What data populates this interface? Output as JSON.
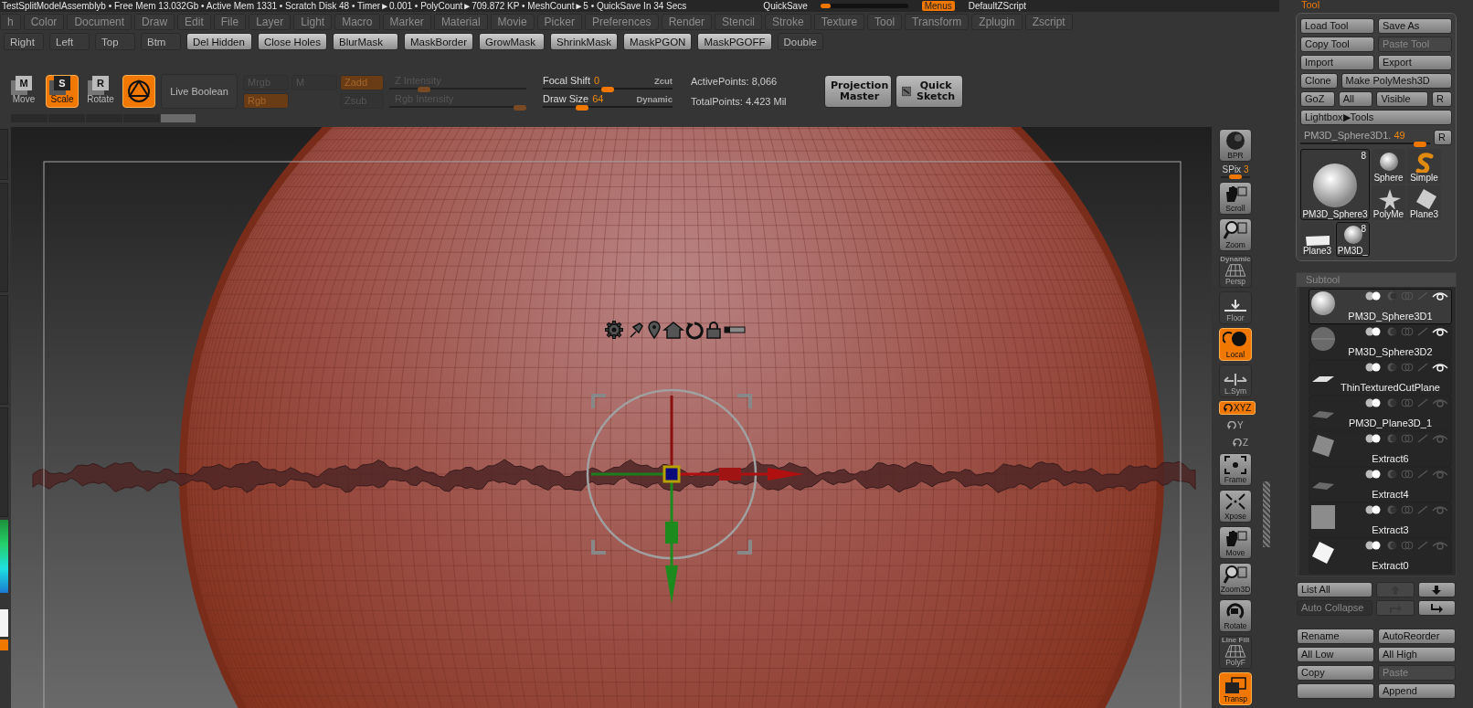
{
  "status_bar": {
    "text": "TestSplitModelAssemblyb  • Free Mem 13.032Gb • Active Mem 1331 • Scratch Disk 48 • Timer►0.001 • PolyCount►709.872 KP • MeshCount►5 • QuickSave In 34 Secs",
    "quicksave": "QuickSave",
    "see_through": {
      "level": 0.12
    },
    "menus": {
      "label": "Menus",
      "on": true
    },
    "script": "DefaultZScript"
  },
  "menu_bar": [
    "h",
    "Color",
    "Document",
    "Draw",
    "Edit",
    "File",
    "Layer",
    "Light",
    "Macro",
    "Marker",
    "Material",
    "Movie",
    "Picker",
    "Preferences",
    "Render",
    "Stencil",
    "Stroke",
    "Texture",
    "Tool",
    "Transform",
    "Zplugin",
    "Zscript"
  ],
  "custom_buttons": [
    {
      "label": "Right",
      "kind": "plain"
    },
    {
      "label": "Left",
      "kind": "plain"
    },
    {
      "label": "Top",
      "kind": "plain"
    },
    {
      "label": "Btm",
      "kind": "plain"
    },
    {
      "label": "Del Hidden",
      "kind": "raised"
    },
    {
      "label": "Close Holes",
      "kind": "raised"
    },
    {
      "label": "BlurMask",
      "kind": "raised"
    },
    {
      "label": "MaskBorder",
      "kind": "raised"
    },
    {
      "label": "GrowMask",
      "kind": "raised"
    },
    {
      "label": "ShrinkMask",
      "kind": "raised"
    },
    {
      "label": "MaskPGON",
      "kind": "raised"
    },
    {
      "label": "MaskPGOFF",
      "kind": "raised"
    },
    {
      "label": "Double",
      "kind": "plain"
    }
  ],
  "transform_modes": [
    {
      "label": "Move",
      "key": "M",
      "selected": false
    },
    {
      "label": "Scale",
      "key": "S",
      "selected": true
    },
    {
      "label": "Rotate",
      "key": "R",
      "selected": false
    }
  ],
  "edit_mode": {
    "on": true
  },
  "live_boolean": {
    "label": "Live Boolean",
    "on": false
  },
  "channels": [
    {
      "label": "Mrgb",
      "on": false
    },
    {
      "label": "M",
      "on": false
    },
    {
      "label": "Zadd",
      "on": true
    },
    {
      "label": "Rgb",
      "on": true
    },
    {
      "label": "Zsub",
      "on": false
    }
  ],
  "intensity_sliders": [
    {
      "label": "Z Intensity",
      "level": 0.25
    },
    {
      "label": "Rgb Intensity",
      "level": 0.95
    }
  ],
  "brush_sliders": [
    {
      "label": "Focal Shift",
      "value": "0",
      "level": 0.5,
      "note": "Zcut"
    },
    {
      "label": "Draw Size",
      "value": "64",
      "level": 0.3,
      "note": "Dynamic"
    }
  ],
  "stats": [
    "ActivePoints: 8,066",
    "TotalPoints: 4.423 Mil"
  ],
  "projection_master": "Projection Master",
  "quick_sketch": "Quick Sketch",
  "shelf": [
    {
      "kind": "action",
      "label": "BPR"
    },
    {
      "kind": "slider",
      "label": "SPix",
      "value": "3",
      "level": 0.5
    },
    {
      "kind": "action",
      "label": "Scroll"
    },
    {
      "kind": "action",
      "label": "Zoom"
    },
    {
      "kind": "toggle",
      "label": "Persp",
      "caption": "Dynamic",
      "on": false
    },
    {
      "kind": "toggle",
      "label": "Floor",
      "on": false
    },
    {
      "kind": "toggle",
      "label": "Local",
      "on": true
    },
    {
      "kind": "toggle",
      "label": "L.Sym",
      "on": false
    },
    {
      "kind": "axis",
      "label": "XYZ",
      "on": true
    },
    {
      "kind": "axis",
      "label": "Y",
      "on": false
    },
    {
      "kind": "axis",
      "label": "Z",
      "on": false
    },
    {
      "kind": "action",
      "label": "Frame"
    },
    {
      "kind": "action",
      "label": "Xpose"
    },
    {
      "kind": "action",
      "label": "Move"
    },
    {
      "kind": "action",
      "label": "Zoom3D"
    },
    {
      "kind": "action",
      "label": "Rotate"
    },
    {
      "kind": "toggle",
      "label": "PolyF",
      "caption": "Line Fill",
      "on": false
    },
    {
      "kind": "toggle",
      "label": "Transp",
      "on": true
    }
  ],
  "tool_palette": {
    "title": "Tool",
    "button_rows": [
      [
        {
          "label": "Load Tool",
          "disabled": false
        },
        {
          "label": "Save As",
          "disabled": false
        }
      ],
      [
        {
          "label": "Copy Tool",
          "disabled": false
        },
        {
          "label": "Paste Tool",
          "disabled": true
        }
      ],
      [
        {
          "label": "Import",
          "disabled": false
        },
        {
          "label": "Export",
          "disabled": false
        }
      ],
      [
        {
          "label": "Clone",
          "disabled": false
        },
        {
          "label": "Make PolyMesh3D",
          "disabled": false
        }
      ],
      [
        {
          "label": "GoZ",
          "disabled": false
        },
        {
          "label": "All",
          "disabled": false
        },
        {
          "label": "Visible",
          "disabled": false
        },
        {
          "label": "R",
          "disabled": false
        }
      ],
      [
        {
          "label": "Lightbox▶Tools",
          "disabled": false
        }
      ]
    ],
    "tool_slider": {
      "label": "PM3D_Sphere3D1.",
      "value": "49",
      "level": 0.92
    },
    "reset": "R",
    "thumbnails": [
      {
        "label": "PM3D_Sphere3",
        "badge": "8",
        "kind": "sphere",
        "selected": true
      },
      {
        "label": "Sphere",
        "kind": "sphere",
        "selected": false
      },
      {
        "label": "Simple",
        "kind": "snake",
        "selected": false
      },
      {
        "label": "PolyMe",
        "kind": "star",
        "selected": false
      },
      {
        "label": "Plane3",
        "kind": "plane",
        "selected": false
      },
      {
        "label": "Plane3",
        "kind": "flat",
        "selected": false
      },
      {
        "label": "PM3D_",
        "badge": "8",
        "kind": "sphere",
        "selected": true
      }
    ]
  },
  "subtool": {
    "title": "Subtool",
    "items": [
      {
        "name": "PM3D_Sphere3D1",
        "kind": "sphere",
        "selected": true,
        "visible": true
      },
      {
        "name": "PM3D_Sphere3D2",
        "kind": "sphere-dim",
        "selected": false,
        "visible": true
      },
      {
        "name": "ThinTexturedCutPlane",
        "kind": "plane",
        "selected": false,
        "visible": true
      },
      {
        "name": "PM3D_Plane3D_1",
        "kind": "plane-dim",
        "selected": false,
        "visible": false
      },
      {
        "name": "Extract6",
        "kind": "tile",
        "selected": false,
        "visible": false
      },
      {
        "name": "Extract4",
        "kind": "plane-dim",
        "selected": false,
        "visible": false
      },
      {
        "name": "Extract3",
        "kind": "square",
        "selected": false,
        "visible": false
      },
      {
        "name": "Extract0",
        "kind": "tile-white",
        "selected": false,
        "visible": false
      }
    ],
    "list_rows": [
      [
        {
          "kind": "button",
          "label": "List All",
          "disabled": false
        },
        {
          "kind": "up-arrow",
          "disabled": true
        },
        {
          "kind": "down-arrow",
          "disabled": false
        }
      ],
      [
        {
          "kind": "toggle",
          "label": "Auto Collapse",
          "disabled": false
        },
        {
          "kind": "turn-arrow",
          "disabled": true
        },
        {
          "kind": "insert-arrow",
          "disabled": false
        }
      ]
    ],
    "action_rows": [
      [
        {
          "label": "Rename",
          "disabled": false
        },
        {
          "label": "AutoReorder",
          "disabled": false
        }
      ],
      [
        {
          "label": "All Low",
          "disabled": false
        },
        {
          "label": "All High",
          "disabled": false
        }
      ],
      [
        {
          "label": "Copy",
          "disabled": false
        },
        {
          "label": "Paste",
          "disabled": true
        }
      ],
      [
        {
          "disabled": false
        },
        {
          "label": "Append",
          "disabled": false
        }
      ]
    ]
  }
}
